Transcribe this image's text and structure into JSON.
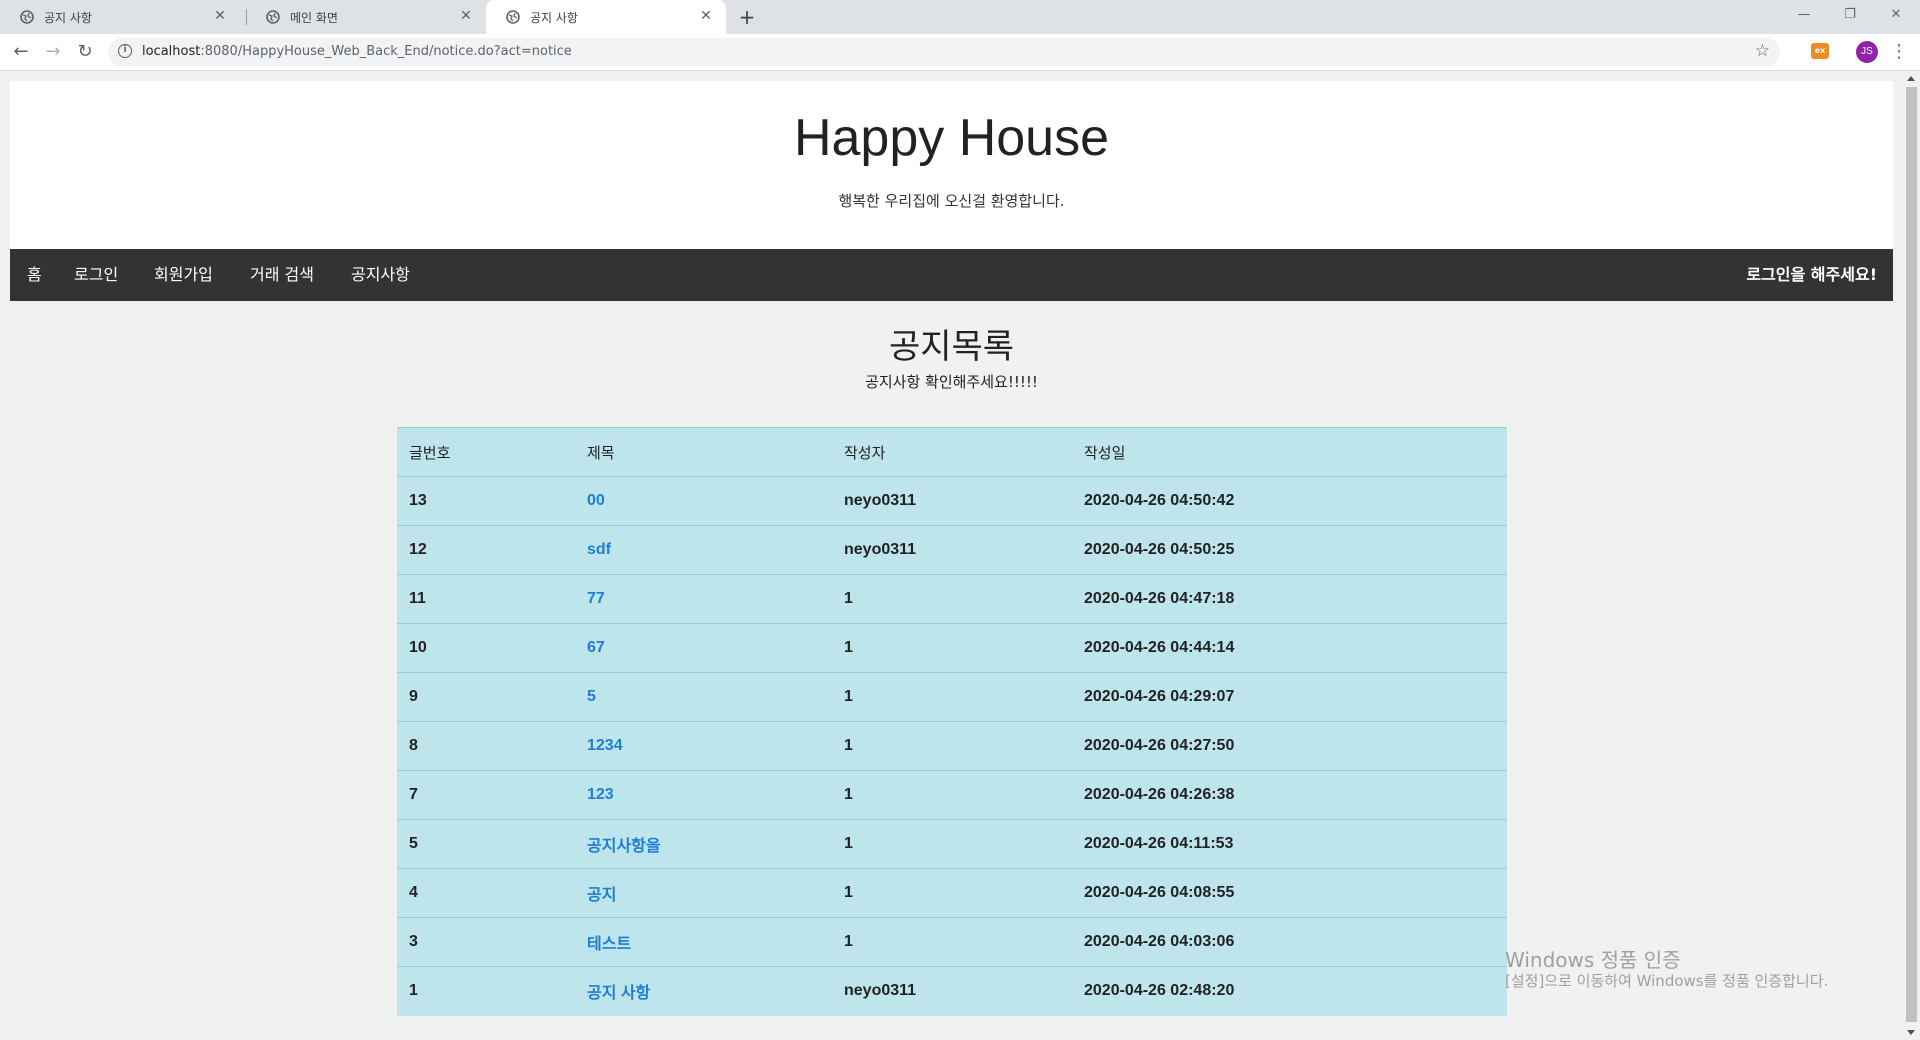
{
  "browser": {
    "tabs": [
      {
        "title": "공지 사항",
        "active": false
      },
      {
        "title": "메인 화면",
        "active": false
      },
      {
        "title": "공지 사항",
        "active": true
      }
    ],
    "url_host": "localhost",
    "url_path": ":8080/HappyHouse_Web_Back_End/notice.do?act=notice",
    "extension_label": "ex",
    "avatar_initials": "JS"
  },
  "header": {
    "title": "Happy House",
    "subtitle": "행복한 우리집에 오신걸 환영합니다."
  },
  "nav": {
    "items": [
      "홈",
      "로그인",
      "회원가입",
      "거래 검색",
      "공지사항"
    ],
    "right_text": "로그인을 해주세요!"
  },
  "main": {
    "heading": "공지목록",
    "subheading": "공지사항 확인해주세요!!!!!",
    "columns": [
      "글번호",
      "제목",
      "작성자",
      "작성일"
    ],
    "rows": [
      {
        "no": "13",
        "title": "00",
        "author": "neyo0311",
        "date": "2020-04-26 04:50:42"
      },
      {
        "no": "12",
        "title": "sdf",
        "author": "neyo0311",
        "date": "2020-04-26 04:50:25"
      },
      {
        "no": "11",
        "title": "77",
        "author": "1",
        "date": "2020-04-26 04:47:18"
      },
      {
        "no": "10",
        "title": "67",
        "author": "1",
        "date": "2020-04-26 04:44:14"
      },
      {
        "no": "9",
        "title": "5",
        "author": "1",
        "date": "2020-04-26 04:29:07"
      },
      {
        "no": "8",
        "title": "1234",
        "author": "1",
        "date": "2020-04-26 04:27:50"
      },
      {
        "no": "7",
        "title": "123",
        "author": "1",
        "date": "2020-04-26 04:26:38"
      },
      {
        "no": "5",
        "title": "공지사항을",
        "author": "1",
        "date": "2020-04-26 04:11:53"
      },
      {
        "no": "4",
        "title": "공지",
        "author": "1",
        "date": "2020-04-26 04:08:55"
      },
      {
        "no": "3",
        "title": "테스트",
        "author": "1",
        "date": "2020-04-26 04:03:06"
      },
      {
        "no": "1",
        "title": "공지 사항",
        "author": "neyo0311",
        "date": "2020-04-26 02:48:20"
      }
    ]
  },
  "watermark": {
    "line1": "Windows 정품 인증",
    "line2": "[설정]으로 이동하여 Windows를 정품 인증합니다."
  },
  "colors": {
    "navbar_bg": "#333333",
    "table_bg": "#bee5eb",
    "link": "#1e7fd1"
  }
}
